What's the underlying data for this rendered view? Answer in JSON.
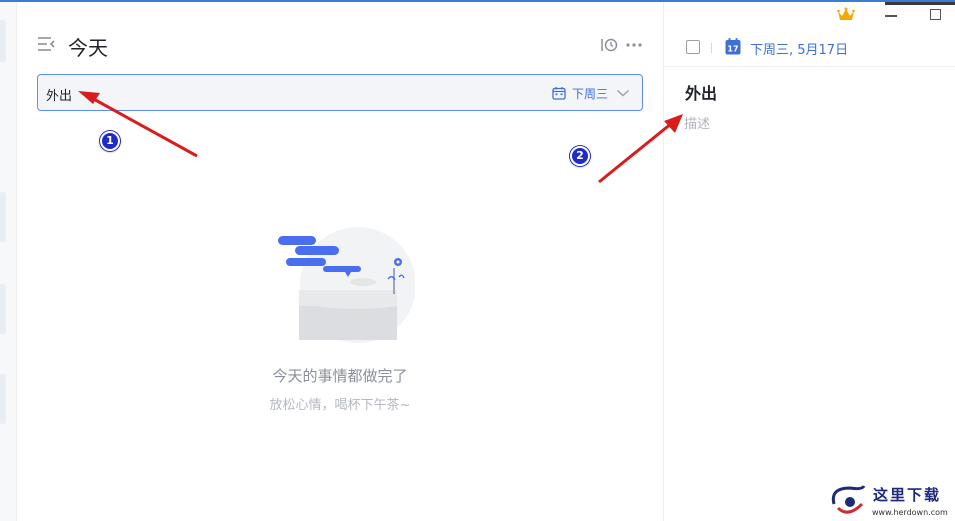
{
  "header": {
    "title": "今天",
    "menu_icon": "collapse-sidebar-icon",
    "sort_icon": "sort-by-time-icon",
    "more_icon": "more-dots-icon"
  },
  "task_input": {
    "value": "外出",
    "date_label": "下周三",
    "date_icon": "calendar-icon",
    "dropdown_icon": "chevron-down-icon"
  },
  "empty_state": {
    "title": "今天的事情都做完了",
    "subtitle": "放松心情，喝杯下午茶~"
  },
  "detail": {
    "date": "下周三, 5月17日",
    "calendar_day": "17",
    "task_title": "外出",
    "description_placeholder": "描述"
  },
  "annotations": {
    "badge_1": "1",
    "badge_2": "2",
    "arrow_color": "#d91c1c"
  },
  "watermark": {
    "text": "这里下载",
    "url": "www.herdown.com"
  },
  "colors": {
    "accent": "#3d6fd8",
    "badge": "#1f2bc9",
    "crown": "#f2a900"
  }
}
